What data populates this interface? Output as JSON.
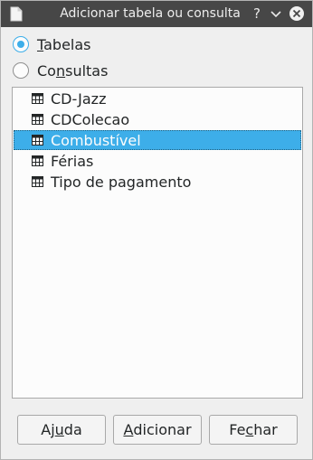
{
  "window": {
    "title": "Adicionar tabela ou consulta",
    "help_glyph": "?"
  },
  "radios": [
    {
      "pre": "",
      "mn": "T",
      "post": "abelas",
      "checked": true
    },
    {
      "pre": "Co",
      "mn": "n",
      "post": "sultas",
      "checked": false
    }
  ],
  "list": {
    "items": [
      {
        "label": "CD-Jazz",
        "selected": false
      },
      {
        "label": "CDColecao",
        "selected": false
      },
      {
        "label": "Combustível",
        "selected": true
      },
      {
        "label": "Férias",
        "selected": false
      },
      {
        "label": "Tipo de pagamento",
        "selected": false
      }
    ]
  },
  "buttons": {
    "help": {
      "pre": "Aj",
      "mn": "u",
      "post": "da"
    },
    "add": {
      "pre": "",
      "mn": "A",
      "post": "dicionar"
    },
    "close": {
      "pre": "Fe",
      "mn": "c",
      "post": "har"
    }
  },
  "colors": {
    "titlebar": "#474747",
    "accent": "#3daee9",
    "background": "#efefef",
    "list_background": "#fcfcfc"
  }
}
